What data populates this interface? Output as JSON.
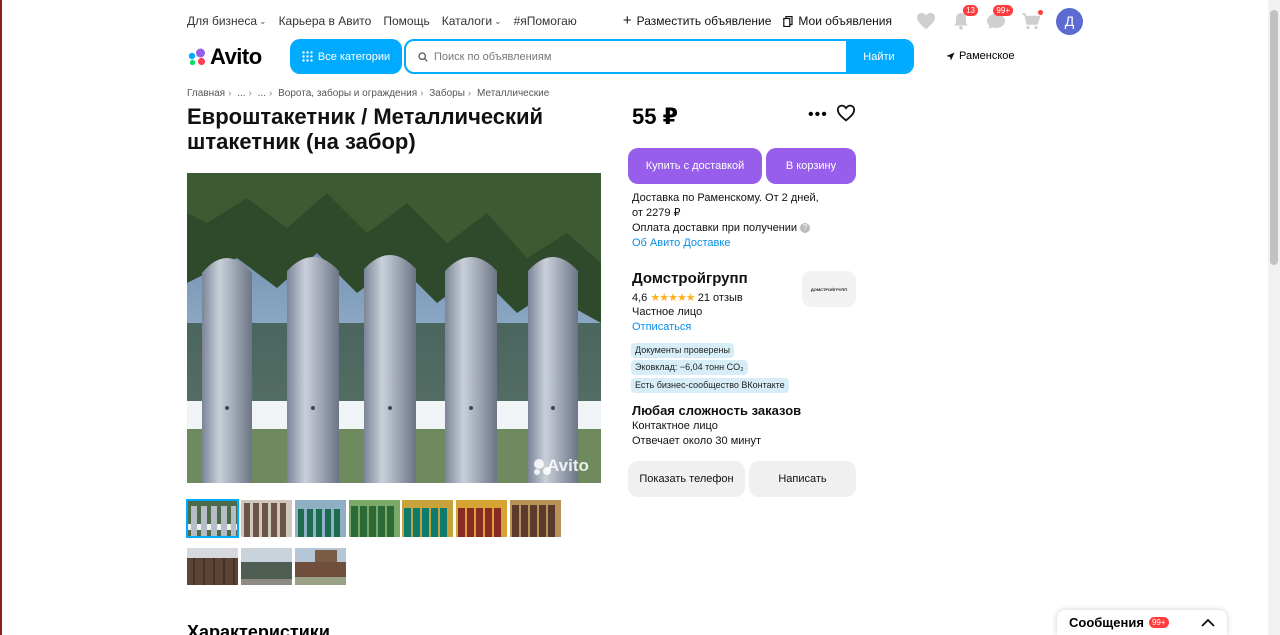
{
  "topnav": {
    "links": [
      {
        "label": "Для бизнеса",
        "dropdown": true
      },
      {
        "label": "Карьера в Авито",
        "dropdown": false
      },
      {
        "label": "Помощь",
        "dropdown": false
      },
      {
        "label": "Каталоги",
        "dropdown": true
      },
      {
        "label": "#яПомогаю",
        "dropdown": false
      }
    ],
    "post_ad": "Разместить объявление",
    "my_ads": "Мои объявления",
    "notifications_badge": "13",
    "messages_badge": "99+",
    "avatar_letter": "Д"
  },
  "header": {
    "logo": "Avito",
    "categories_button": "Все категории",
    "search_placeholder": "Поиск по объявлениям",
    "search_button": "Найти",
    "location": "Раменское"
  },
  "breadcrumbs": [
    "Главная",
    "...",
    "...",
    "Ворота, заборы и ограждения",
    "Заборы",
    "Металлические"
  ],
  "listing": {
    "title": "Евроштакетник / Металлический штакетник (на забор)",
    "price": "55 ₽",
    "watermark": "Avito",
    "characteristics_title": "Характеристики"
  },
  "actions": {
    "buy_delivery": "Купить с доставкой",
    "to_cart": "В корзину"
  },
  "delivery": {
    "line1": "Доставка по Раменскому. От 2 дней,",
    "line2": "от 2279 ₽",
    "line3": "Оплата доставки при получении",
    "link": "Об Авито Доставке"
  },
  "seller": {
    "name": "Домстройгрупп",
    "rating": "4,6",
    "stars": "★★★★★",
    "reviews": "21 отзыв",
    "type": "Частное лицо",
    "unsubscribe": "Отписаться",
    "logo_text": "ДОМСТРОЙГРУПП"
  },
  "tags": [
    "Документы проверены",
    "Эковклад: −6,04 тонн CO₂",
    "Есть бизнес-сообщество ВКонтакте"
  ],
  "contact": {
    "heading": "Любая сложность заказов",
    "person": "Контактное лицо",
    "response": "Отвечает около 30 минут",
    "show_phone": "Показать телефон",
    "write": "Написать"
  },
  "messages_panel": {
    "label": "Сообщения",
    "badge": "99+"
  },
  "colors": {
    "accent_blue": "#00aaff",
    "purple": "#965eeb",
    "badge_red": "#ff3b3b"
  }
}
